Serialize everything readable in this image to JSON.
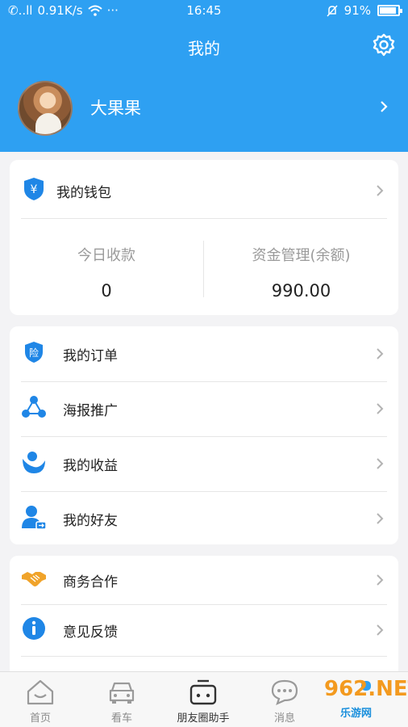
{
  "status_bar": {
    "carrier": "✆..ll",
    "speed": "0.91K/s",
    "time": "16:45",
    "battery": "91%",
    "battery_level": 0.91,
    "more": "···"
  },
  "header": {
    "title": "我的",
    "settings_icon": "gear-icon"
  },
  "profile": {
    "name": "大果果",
    "avatar": "avatar-photo"
  },
  "wallet": {
    "label": "我的钱包",
    "icon": "yen-shield-icon",
    "today_label": "今日收款",
    "today_value": "0",
    "balance_label": "资金管理(余额)",
    "balance_value": "990.00"
  },
  "menu_group_1": {
    "items": [
      {
        "label": "我的订单",
        "icon": "insurance-shield-icon"
      },
      {
        "label": "海报推广",
        "icon": "share-nodes-icon"
      },
      {
        "label": "我的收益",
        "icon": "profit-icon"
      },
      {
        "label": "我的好友",
        "icon": "friend-icon"
      }
    ]
  },
  "menu_group_2": {
    "items": [
      {
        "label": "商务合作",
        "icon": "handshake-icon"
      },
      {
        "label": "意见反馈",
        "icon": "info-icon"
      }
    ]
  },
  "tabbar": {
    "items": [
      {
        "label": "首页",
        "icon": "home-icon"
      },
      {
        "label": "看车",
        "icon": "car-icon"
      },
      {
        "label": "朋友圈助手",
        "icon": "friends-helper-icon"
      },
      {
        "label": "消息",
        "icon": "message-icon"
      },
      {
        "label": "",
        "icon": "profile-icon"
      }
    ]
  },
  "watermark": {
    "text": "962.NET",
    "sub": "乐游网"
  },
  "colors": {
    "primary": "#2ea0f2",
    "icon_blue": "#1f86e6",
    "handshake_orange": "#f0a32a"
  }
}
